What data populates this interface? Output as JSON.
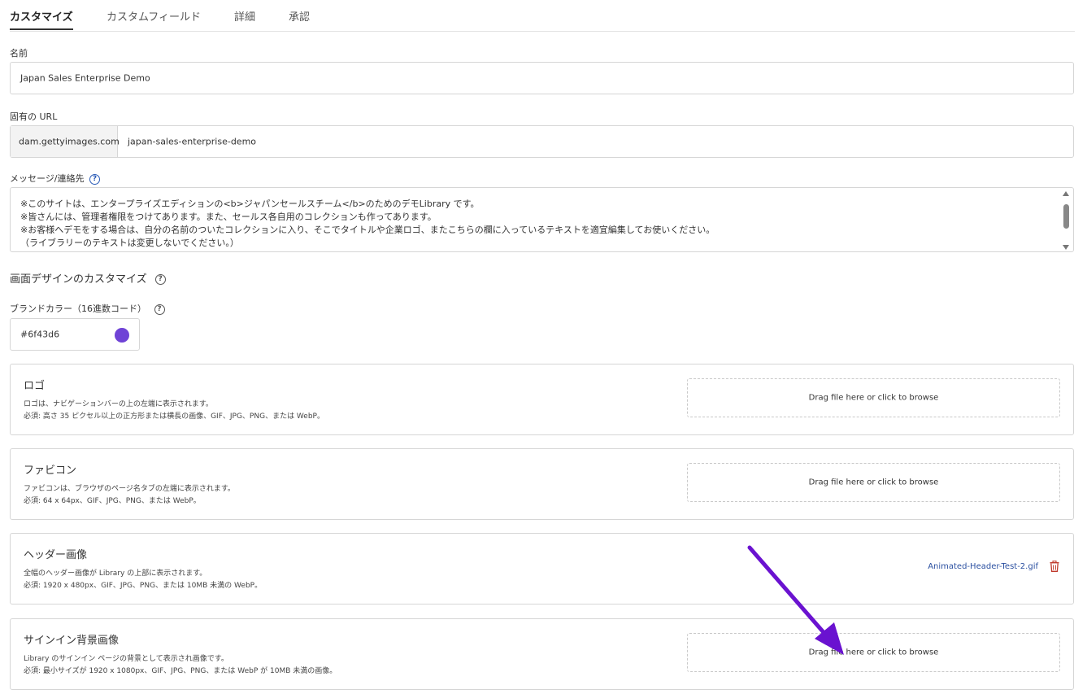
{
  "tabs": [
    {
      "label": "カスタマイズ"
    },
    {
      "label": "カスタムフィールド"
    },
    {
      "label": "詳細"
    },
    {
      "label": "承認"
    }
  ],
  "name_field": {
    "label": "名前",
    "value": "Japan Sales Enterprise Demo"
  },
  "url_field": {
    "label": "固有の URL",
    "prefix": "dam.gettyimages.com",
    "value": "japan-sales-enterprise-demo"
  },
  "message_field": {
    "label": "メッセージ/連絡先",
    "lines": [
      "※このサイトは、エンタープライズエディションの<b>ジャパンセールスチーム</b>のためのデモLibrary です。",
      "※皆さんには、管理者権限をつけてあります。また、セールス各自用のコレクションも作ってあります。",
      "※お客様へデモをする場合は、自分の名前のついたコレクションに入り、そこでタイトルや企業ロゴ、またこちらの欄に入っているテキストを適宜編集してお使いください。",
      "（ライブラリーのテキストは変更しないでください。）"
    ]
  },
  "design_section": {
    "title": "画面デザインのカスタマイズ"
  },
  "brand_color": {
    "label": "ブランドカラー（16進数コード）",
    "value": "#6f43d6",
    "swatch_color": "#6f43d6"
  },
  "cards": [
    {
      "title": "ロゴ",
      "desc1": "ロゴは、ナビゲーションバーの上の左端に表示されます。",
      "desc2": "必須: 高さ 35 ピクセル以上の正方形または横長の画像、GIF、JPG、PNG、または WebP。",
      "dropzone": "Drag file here or click to browse"
    },
    {
      "title": "ファビコン",
      "desc1": "ファビコンは、ブラウザのページ名タブの左端に表示されます。",
      "desc2": "必須: 64 x 64px、GIF、JPG、PNG、または WebP。",
      "dropzone": "Drag file here or click to browse"
    },
    {
      "title": "ヘッダー画像",
      "desc1": "全幅のヘッダー画像が Library の上部に表示されます。",
      "desc2": "必須: 1920 x 480px、GIF、JPG、PNG、または 10MB 未満の WebP。",
      "file_name": "Animated-Header-Test-2.gif"
    },
    {
      "title": "サインイン背景画像",
      "desc1": "Library のサインイン ページの背景として表示され画像です。",
      "desc2": "必須: 最小サイズが 1920 x 1080px、GIF、JPG、PNG、または WebP が 10MB 未満の画像。",
      "dropzone": "Drag file here or click to browse"
    }
  ],
  "colors": {
    "accent": "#6f43d6",
    "arrow": "#6a12d0",
    "link": "#2a4fa0",
    "delete": "#c0392b"
  }
}
